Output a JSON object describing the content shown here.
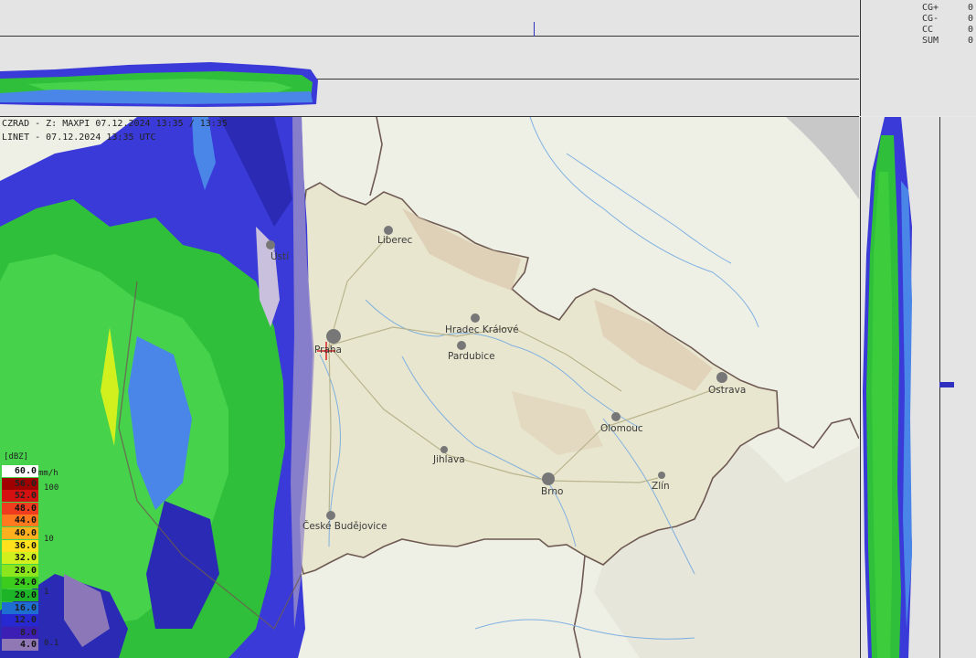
{
  "header": {
    "radar_line": "CZRAD - Z: MAXPI 07.12.2024 13:35 / 13:35",
    "linet_line": "LINET - 07.12.2024 13:35 UTC"
  },
  "lightning_stats": [
    {
      "label": "CG+",
      "value": "0"
    },
    {
      "label": "CG-",
      "value": "0"
    },
    {
      "label": "CC",
      "value": "0"
    },
    {
      "label": "SUM",
      "value": "0"
    }
  ],
  "cities": [
    "Liberec",
    "Praha",
    "Hradec Králové",
    "Pardubice",
    "Ostrava",
    "Olomouc",
    "Jihlava",
    "Brno",
    "Zlín",
    "České Budějovice",
    "Ústí"
  ],
  "legend": {
    "title": "[dBZ]",
    "unit": "mm/h",
    "levels": [
      {
        "label": "60.0",
        "color": "#ffffff"
      },
      {
        "label": "56.0",
        "color": "#a00000"
      },
      {
        "label": "52.0",
        "color": "#d41010"
      },
      {
        "label": "48.0",
        "color": "#f03c1e"
      },
      {
        "label": "44.0",
        "color": "#ff7a1e"
      },
      {
        "label": "40.0",
        "color": "#ffb01e"
      },
      {
        "label": "36.0",
        "color": "#ffe11e"
      },
      {
        "label": "32.0",
        "color": "#d2f01e"
      },
      {
        "label": "28.0",
        "color": "#8ce61e"
      },
      {
        "label": "24.0",
        "color": "#3ccc1e"
      },
      {
        "label": "20.0",
        "color": "#1eb428"
      },
      {
        "label": "16.0",
        "color": "#1e6ed2"
      },
      {
        "label": "12.0",
        "color": "#2828d2"
      },
      {
        "label": "8.0",
        "color": "#3c1eb4"
      },
      {
        "label": "4.0",
        "color": "#9078b4"
      }
    ],
    "rate_ticks": [
      "100",
      "10",
      "1",
      "0.1"
    ]
  },
  "colors": {
    "panel_bg": "#e4e4e4",
    "country_fill": "#e9e6d0",
    "border": "#6e5a52",
    "radar_green": "#2ec832",
    "radar_blue": "#2d32d2"
  }
}
